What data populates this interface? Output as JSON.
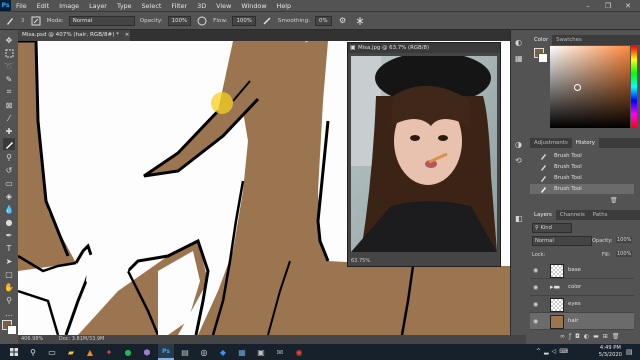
{
  "menubar": {
    "logo": "Ps",
    "items": [
      "File",
      "Edit",
      "Image",
      "Layer",
      "Type",
      "Select",
      "Filter",
      "3D",
      "View",
      "Window",
      "Help"
    ],
    "window_controls": [
      "–",
      "❐",
      "✕"
    ]
  },
  "options": {
    "mode_label": "Mode:",
    "mode_value": "Normal",
    "opacity_label": "Opacity:",
    "opacity_value": "100%",
    "flow_label": "Flow:",
    "flow_value": "100%",
    "smoothing_label": "Smoothing:",
    "smoothing_value": "0%",
    "brush_size": "3"
  },
  "document": {
    "tab_title": "Misa.psd @ 407% (hair, RGB/8#) *",
    "tab_close": "×",
    "zoom": "406.98%",
    "doc_info": "Doc: 3.81M/33.9M"
  },
  "floating_window": {
    "title": "Misa.jpg @ 63.7% (RGB/8)",
    "zoom": "63.75%"
  },
  "color_panel": {
    "tabs": [
      "Color",
      "Swatches"
    ],
    "hue_color": "#ff8a3c"
  },
  "history_panel": {
    "tabs": [
      "Adjustments",
      "History"
    ],
    "items": [
      "Brush Tool",
      "Brush Tool",
      "Brush Tool",
      "Brush Tool"
    ]
  },
  "layers_panel": {
    "tabs": [
      "Layers",
      "Channels",
      "Paths"
    ],
    "kind_label": "Kind",
    "blend_mode": "Normal",
    "opacity_label": "Opacity:",
    "opacity_value": "100%",
    "lock_label": "Lock:",
    "fill_label": "Fill:",
    "fill_value": "100%",
    "layers": [
      {
        "name": "base",
        "type": "layer"
      },
      {
        "name": "color",
        "type": "group"
      },
      {
        "name": "eyes",
        "type": "layer"
      },
      {
        "name": "hair",
        "type": "layer"
      }
    ]
  },
  "taskbar": {
    "time": "4:49 PM",
    "date": "5/3/2020"
  },
  "colors": {
    "hair_fill": "#9a7550",
    "ps_blue": "#31a8ff",
    "cursor": "#f5d020"
  }
}
